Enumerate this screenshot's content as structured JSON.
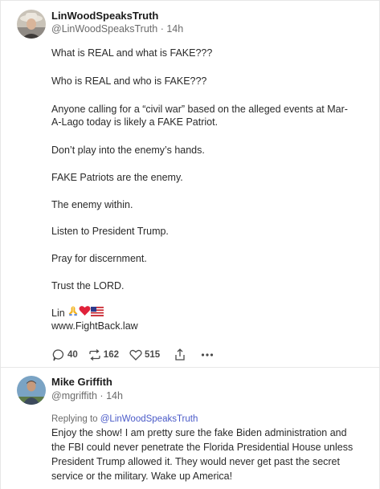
{
  "post": {
    "author_name": "LinWoodSpeaksTruth",
    "author_handle": "@LinWoodSpeaksTruth",
    "separator": "·",
    "time": "14h",
    "paragraphs": [
      "What is REAL and what is FAKE???",
      "Who is REAL and who is FAKE???",
      "Anyone calling for a “civil war” based on the alleged events at Mar-",
      "A-Lago today is likely a FAKE Patriot.",
      "Don’t play into the enemy’s hands.",
      "FAKE Patriots are the enemy.",
      "The enemy within.",
      "Listen to President Trump.",
      "Pray for discernment.",
      "Trust the LORD.",
      "Lin",
      "www.FightBack.law"
    ],
    "emoji_names": [
      "praying-hands-icon",
      "red-heart-icon",
      "us-flag-icon"
    ],
    "actions": {
      "replies": "40",
      "retruths": "162",
      "likes": "515"
    }
  },
  "reply": {
    "author_name": "Mike Griffith",
    "author_handle": "@mgriffith",
    "separator": "·",
    "time": "14h",
    "replying_prefix": "Replying to",
    "replying_handle": "@LinWoodSpeaksTruth",
    "lines": [
      "Enjoy the show! I am pretty sure the fake Biden administration and",
      "the FBI could never penetrate the Florida Presidential House unless",
      "President Trump allowed it. They would never get past the secret",
      "service or the military. Wake up America!"
    ]
  },
  "colors": {
    "text": "#2a2a2a",
    "muted": "#6b6b6b",
    "link": "#4a5ac8",
    "heart": "#e0223a"
  }
}
